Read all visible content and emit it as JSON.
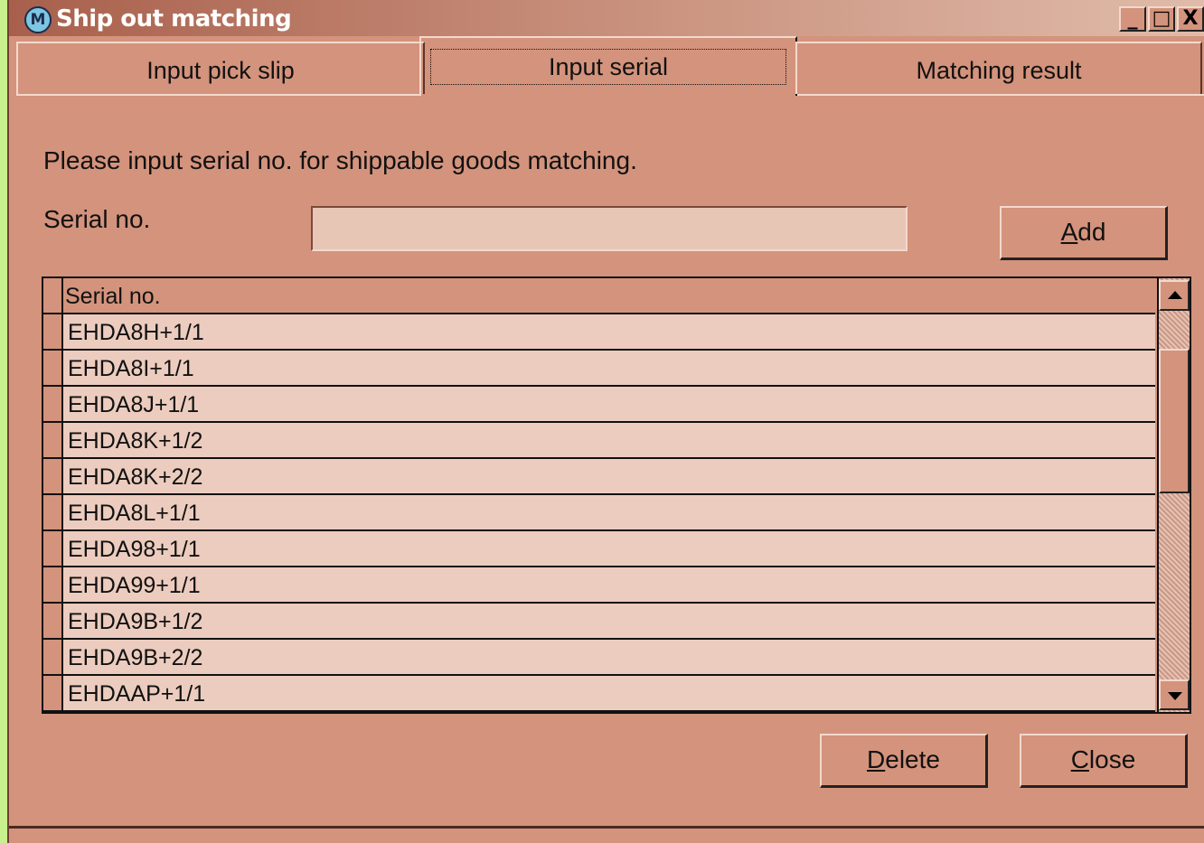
{
  "window": {
    "title": "Ship out matching",
    "icon": "app-logo-icon",
    "controls": {
      "minimize": "_",
      "maximize": "□",
      "close": "X"
    }
  },
  "tabs": [
    {
      "label": "Input pick slip",
      "active": false
    },
    {
      "label": "Input serial",
      "active": true
    },
    {
      "label": "Matching result",
      "active": false
    }
  ],
  "form": {
    "instruction": "Please input serial no. for shippable goods matching.",
    "serial_label": "Serial no.",
    "serial_value": "",
    "add_button": {
      "accel": "A",
      "rest": "dd"
    }
  },
  "grid": {
    "header": "Serial no.",
    "rows": [
      "EHDA8H+1/1",
      "EHDA8I+1/1",
      "EHDA8J+1/1",
      "EHDA8K+1/2",
      "EHDA8K+2/2",
      "EHDA8L+1/1",
      "EHDA98+1/1",
      "EHDA99+1/1",
      "EHDA9B+1/2",
      "EHDA9B+2/2",
      "EHDAAP+1/1"
    ]
  },
  "buttons": {
    "delete": {
      "accel": "D",
      "rest": "elete"
    },
    "close": {
      "accel": "C",
      "rest": "lose"
    }
  },
  "colors": {
    "window_bg": "#d4937c",
    "cell_bg": "#ecccbe",
    "desktop_bg": "#c8f08c"
  }
}
